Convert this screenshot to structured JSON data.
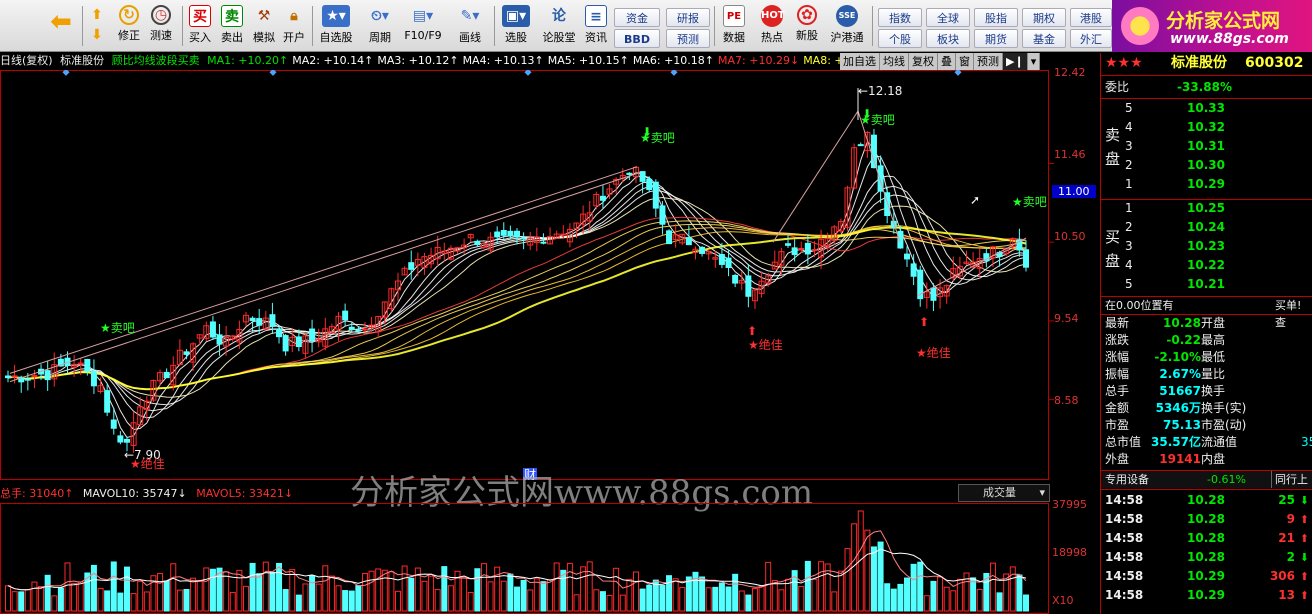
{
  "toolbar": {
    "buttons": [
      {
        "label": "",
        "icon": "back-arrow-icon"
      },
      {
        "label": "修正",
        "icon": "fix-icon"
      },
      {
        "label": "测速",
        "icon": "speed-icon"
      },
      {
        "label": "买入",
        "icon": "buy-icon",
        "glyph": "买"
      },
      {
        "label": "卖出",
        "icon": "sell-icon",
        "glyph": "卖"
      },
      {
        "label": "模拟",
        "icon": "hammer-icon"
      },
      {
        "label": "开户",
        "icon": "lock-icon"
      },
      {
        "label": "自选股",
        "icon": "star-icon"
      },
      {
        "label": "周期",
        "icon": "clock-icon"
      },
      {
        "label": "F10/F9",
        "icon": "f10-icon"
      },
      {
        "label": "画线",
        "icon": "pen-icon"
      },
      {
        "label": "选股",
        "icon": "screen-icon"
      },
      {
        "label": "论股堂",
        "icon": "forum-icon",
        "glyph": "论"
      },
      {
        "label": "资讯",
        "icon": "news-icon"
      },
      {
        "label": "数据",
        "icon": "pe-icon",
        "glyph": "PE"
      },
      {
        "label": "热点",
        "icon": "hot-icon"
      },
      {
        "label": "新股",
        "icon": "new-stock-icon"
      },
      {
        "label": "沪港通",
        "icon": "sse-hke-icon"
      }
    ],
    "grid1": [
      "资金",
      "研报",
      "BBD",
      "预测"
    ],
    "grid2": [
      "指数",
      "全球",
      "股指",
      "期权",
      "港股",
      "个股",
      "板块",
      "期货",
      "基金",
      "外汇"
    ]
  },
  "logo": {
    "title": "分析家公式网",
    "url": "www.88gs.com"
  },
  "chart_header": {
    "period": "日线(复权)",
    "stock": "标准股份",
    "indicator": "顾比均线波段买卖",
    "ma": [
      {
        "label": "MA1:",
        "value": "+10.20↑",
        "color": "#00e000"
      },
      {
        "label": "MA2:",
        "value": "+10.14↑",
        "color": "#ffffff"
      },
      {
        "label": "MA3:",
        "value": "+10.12↑",
        "color": "#ffffff"
      },
      {
        "label": "MA4:",
        "value": "+10.13↑",
        "color": "#ffffff"
      },
      {
        "label": "MA5:",
        "value": "+10.15↑",
        "color": "#ffffff"
      },
      {
        "label": "MA6:",
        "value": "+10.18↑",
        "color": "#ffffff"
      },
      {
        "label": "MA7:",
        "value": "+10.29↓",
        "color": "#ff3030"
      },
      {
        "label": "MA8:",
        "value": "+10.31↓",
        "color": "#ffff33"
      }
    ],
    "buttons": [
      "加自选",
      "均线",
      "复权",
      "叠",
      "窗",
      "预测"
    ]
  },
  "main_axis": [
    "12.42",
    "11.46",
    "11.00",
    "10.50",
    "9.54",
    "8.58"
  ],
  "annotations": {
    "high": "12.18",
    "low": "7.90",
    "sell": "卖吧",
    "buy": "绝佳",
    "cai": "财"
  },
  "watermark": "分析家公式网www.88gs.com",
  "volume_header": {
    "vol": "总手: 31040↑",
    "mavol10": "MAVOL10: 35747↓",
    "mavol5": "MAVOL5: 33421↓",
    "select": "成交量"
  },
  "vol_axis": [
    "37995",
    "18998",
    "X10"
  ],
  "quote": {
    "stars": "★★★",
    "name": "标准股份",
    "code": "600302",
    "weibi_label": "委比",
    "weibi": "-33.88%",
    "sell_label": [
      "卖",
      "盘"
    ],
    "buy_label": [
      "买",
      "盘"
    ],
    "asks": [
      [
        "5",
        "10.33"
      ],
      [
        "4",
        "10.32"
      ],
      [
        "3",
        "10.31"
      ],
      [
        "2",
        "10.30"
      ],
      [
        "1",
        "10.29"
      ]
    ],
    "bids": [
      [
        "1",
        "10.25"
      ],
      [
        "2",
        "10.24"
      ],
      [
        "3",
        "10.23"
      ],
      [
        "4",
        "10.22"
      ],
      [
        "5",
        "10.21"
      ]
    ],
    "position_text": "在0.00位置有",
    "position_right": "买单! 查",
    "stats": [
      [
        "最新",
        "10.28",
        "开盘",
        ""
      ],
      [
        "涨跌",
        "-0.22",
        "最高",
        ""
      ],
      [
        "涨幅",
        "-2.10%",
        "最低",
        ""
      ],
      [
        "振幅",
        "2.67%",
        "量比",
        ""
      ],
      [
        "总手",
        "51667",
        "换手",
        ""
      ],
      [
        "金额",
        "5346万",
        "换手(实)",
        ""
      ],
      [
        "市盈",
        "75.13",
        "市盈(动)",
        ""
      ],
      [
        "总市值",
        "35.57亿",
        "流通值",
        "35"
      ],
      [
        "外盘",
        "19141",
        "内盘",
        ""
      ]
    ],
    "device_label": "专用设备",
    "device_change": "-0.61%",
    "peer": "同行上",
    "ticks": [
      [
        "14:58",
        "10.28",
        "25",
        "down"
      ],
      [
        "14:58",
        "10.28",
        "9",
        "up"
      ],
      [
        "14:58",
        "10.28",
        "21",
        "up"
      ],
      [
        "14:58",
        "10.28",
        "2",
        "down"
      ],
      [
        "14:58",
        "10.29",
        "306",
        "up"
      ],
      [
        "14:58",
        "10.29",
        "13",
        "up"
      ]
    ]
  },
  "chart_data": {
    "type": "candlestick",
    "title": "",
    "ylim": [
      7.6,
      12.6
    ],
    "close_path": [
      [
        0,
        8.85
      ],
      [
        6,
        8.9
      ],
      [
        10,
        9.05
      ],
      [
        14,
        8.75
      ],
      [
        16,
        8.2
      ],
      [
        18,
        8.05
      ],
      [
        20,
        8.55
      ],
      [
        26,
        9.1
      ],
      [
        30,
        9.45
      ],
      [
        33,
        9.25
      ],
      [
        36,
        9.6
      ],
      [
        40,
        9.5
      ],
      [
        42,
        9.25
      ],
      [
        46,
        9.3
      ],
      [
        50,
        9.55
      ],
      [
        54,
        9.45
      ],
      [
        58,
        9.9
      ],
      [
        62,
        10.3
      ],
      [
        66,
        10.4
      ],
      [
        70,
        10.55
      ],
      [
        74,
        10.5
      ],
      [
        78,
        10.5
      ],
      [
        82,
        10.6
      ],
      [
        86,
        10.7
      ],
      [
        90,
        11.1
      ],
      [
        94,
        11.4
      ],
      [
        96,
        11.25
      ],
      [
        98,
        10.9
      ],
      [
        100,
        10.55
      ],
      [
        104,
        10.5
      ],
      [
        108,
        10.2
      ],
      [
        112,
        9.9
      ],
      [
        114,
        10.1
      ],
      [
        118,
        10.4
      ],
      [
        122,
        10.45
      ],
      [
        126,
        10.8
      ],
      [
        128,
        11.6
      ],
      [
        130,
        11.9
      ],
      [
        132,
        11.1
      ],
      [
        134,
        10.7
      ],
      [
        136,
        10.3
      ],
      [
        138,
        9.9
      ],
      [
        140,
        9.8
      ],
      [
        143,
        10.1
      ],
      [
        146,
        10.3
      ],
      [
        150,
        10.4
      ],
      [
        152,
        10.6
      ],
      [
        154,
        10.28
      ]
    ]
  }
}
